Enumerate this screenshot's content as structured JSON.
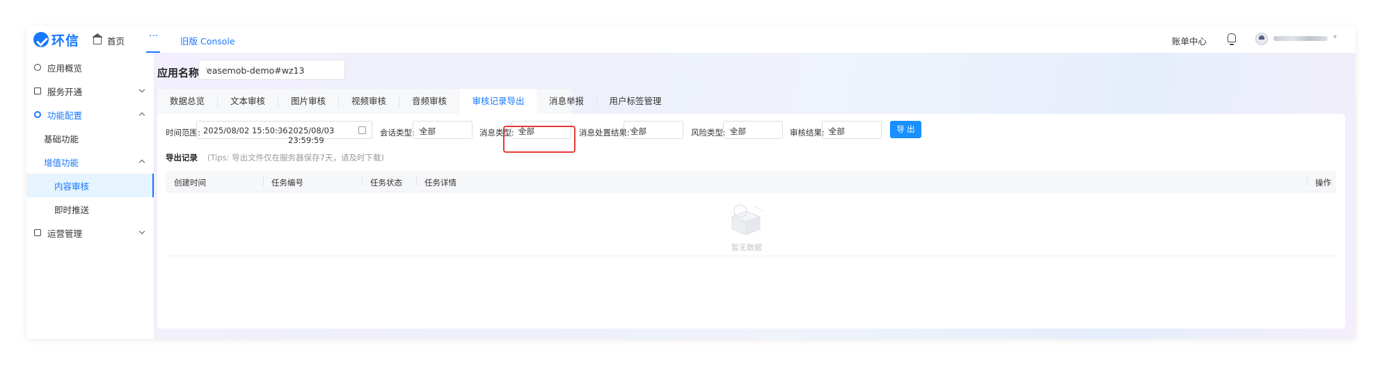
{
  "topbar": {
    "logo_text": "环信",
    "home_label": "首页",
    "more_label": "···",
    "console_link": "旧版 Console",
    "billing_label": "账单中心"
  },
  "sidebar": {
    "items": [
      {
        "label": "应用概览"
      },
      {
        "label": "服务开通"
      },
      {
        "label": "功能配置"
      },
      {
        "label": "基础功能"
      },
      {
        "label": "增值功能"
      },
      {
        "label": "内容审核"
      },
      {
        "label": "即时推送"
      },
      {
        "label": "运营管理"
      }
    ]
  },
  "main": {
    "app_label": "应用名称",
    "app_value": "easemob-demo#wz13",
    "tabs": [
      {
        "label": "数据总览"
      },
      {
        "label": "文本审核"
      },
      {
        "label": "图片审核"
      },
      {
        "label": "视频审核"
      },
      {
        "label": "音频审核"
      },
      {
        "label": "审核记录导出"
      },
      {
        "label": "消息举报"
      },
      {
        "label": "用户标签管理"
      }
    ],
    "active_tab": "审核记录导出",
    "filters": {
      "time_label": "时间范围:",
      "time_start": "2025/08/02 15:50:36",
      "time_arrow": "→",
      "time_end": "2025/08/03 23:59:59",
      "session_label": "会话类型:",
      "session_value": "全部",
      "msg_label": "消息类型:",
      "msg_value": "全部",
      "result_label": "消息处置结果:",
      "result_value": "全部",
      "risk_label": "风险类型:",
      "risk_value": "全部",
      "audit_label": "审核结果:",
      "audit_value": "全部",
      "export_label": "导 出"
    },
    "records": {
      "title": "导出记录",
      "tip": "(Tips: 导出文件仅在服务器保存7天，请及时下载)",
      "columns": [
        "创建时间",
        "任务编号",
        "任务状态",
        "任务详情",
        "操作"
      ],
      "empty_text": "暂无数据"
    }
  }
}
